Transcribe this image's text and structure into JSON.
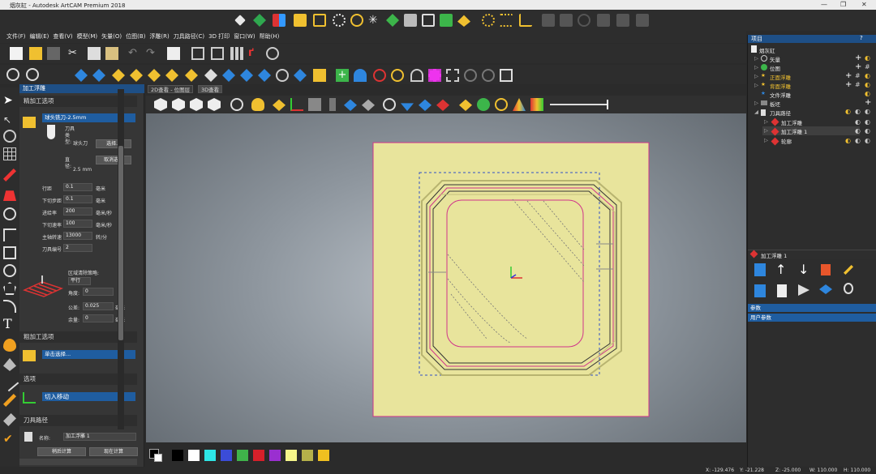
{
  "window": {
    "title": "烟灰缸 - Autodesk ArtCAM Premium 2018",
    "minimize": "—",
    "maximize": "❐",
    "close": "✕"
  },
  "menu": [
    "文件(F)",
    "编辑(E)",
    "查看(V)",
    "模型(M)",
    "矢量(O)",
    "位图(B)",
    "浮雕(R)",
    "刀具路径(C)",
    "3D 打印",
    "窗口(W)",
    "帮助(H)"
  ],
  "left_panel": {
    "title": "加工浮雕",
    "finish_section": "精加工选项",
    "tool_name": "球头铣刀-2.5mm",
    "tool_type_label": "刀具类型:",
    "tool_type_value": "球头刀",
    "diameter_label": "直径:",
    "diameter_value": "2.5 mm",
    "select_button": "选择...",
    "deselect_button": "取消选择",
    "fields": [
      {
        "label": "行距",
        "value": "0.1",
        "unit": "毫米"
      },
      {
        "label": "下切步距",
        "value": "0.1",
        "unit": "毫米"
      },
      {
        "label": "进给率",
        "value": "200",
        "unit": "毫米/秒"
      },
      {
        "label": "下切速率",
        "value": "100",
        "unit": "毫米/秒"
      },
      {
        "label": "主轴转速",
        "value": "13000",
        "unit": "转/分"
      },
      {
        "label": "刀具编号",
        "value": "2",
        "unit": ""
      }
    ],
    "area_clear_label": "区域清除策略:",
    "area_clear_value": "平行",
    "angle_label": "角度:",
    "angle_value": "0",
    "tolerance_label": "公差:",
    "tolerance_value": "0.025",
    "tolerance_unit": "毫米",
    "allowance_label": "余量:",
    "allowance_value": "0",
    "allowance_unit": "毫米",
    "rough_section": "粗加工选项",
    "rough_tool_placeholder": "单击选择...",
    "options_section": "选项",
    "lead_in_label": "切入移动",
    "toolpath_section": "刀具路径",
    "name_label": "名称:",
    "name_value": "加工浮雕 1",
    "calc_later_button": "稍后计算",
    "calc_now_button": "现在计算"
  },
  "tabs": [
    "2D查看 - 位图层",
    "3D查看"
  ],
  "right_panel": {
    "project_title": "项目",
    "help": "?",
    "tree": [
      {
        "label": "烟灰缸",
        "highlight": false
      },
      {
        "label": "矢量",
        "highlight": false
      },
      {
        "label": "位图",
        "highlight": false
      },
      {
        "label": "正面浮雕",
        "highlight": true
      },
      {
        "label": "背面浮雕",
        "highlight": true
      },
      {
        "label": "文件浮雕",
        "highlight": false
      },
      {
        "label": "板坯",
        "highlight": false
      },
      {
        "label": "刀具路径",
        "highlight": false
      },
      {
        "label": "加工浮雕",
        "highlight": false
      },
      {
        "label": "加工浮雕 1",
        "highlight": false
      },
      {
        "label": "轮廓",
        "highlight": false
      }
    ],
    "toolpath_title": "加工浮雕 1",
    "params_bar": "参数",
    "user_params_bar": "用户参数"
  },
  "status": {
    "x": "X: -129.476",
    "y": "Y: -21.228",
    "z": "Z: -25.000",
    "w": "W: 110.000",
    "h": "H: 110.000"
  },
  "colors": {
    "accent": "#1e4f86",
    "panel": "#363636",
    "slab": "#e6e29e",
    "toolpath": "#d0338a"
  },
  "swatches": [
    "#000000",
    "#ffffff",
    "#2ee6e6",
    "#3b4cd8",
    "#3fb34a",
    "#d6202a",
    "#9a2fd0",
    "#f5f58a",
    "#b5b04a",
    "#f0c020"
  ]
}
